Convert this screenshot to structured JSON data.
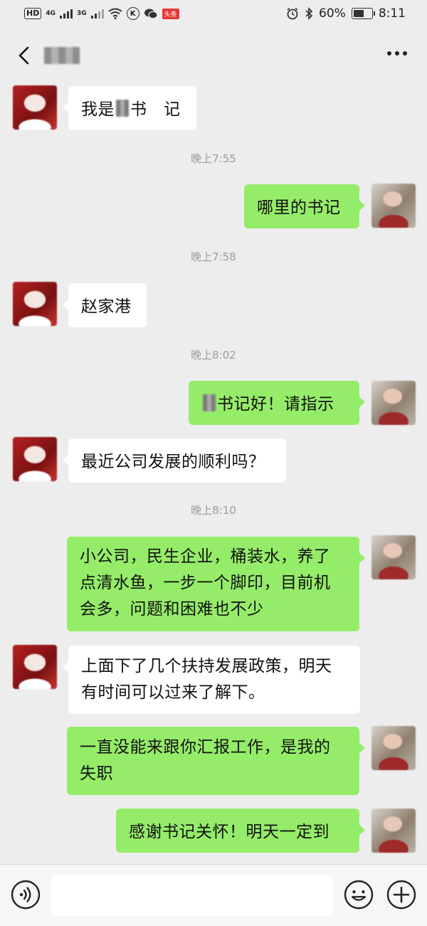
{
  "status_bar": {
    "hd": "HD",
    "net_4g": "4G",
    "net_3g": "3G",
    "k_icon": "K",
    "news_badge": "头条",
    "battery": "60%",
    "battery_level": 0.6,
    "time": "8:11"
  },
  "nav": {
    "back_icon": "chevron-left-icon",
    "more_icon": "ellipsis-icon"
  },
  "colors": {
    "outgoing_bubble": "#95ec69",
    "incoming_bubble": "#ffffff",
    "background": "#ededed"
  },
  "messages": [
    {
      "from": "other",
      "before": "我是",
      "after": "书　记"
    },
    {
      "type": "time",
      "text": "晚上7:55"
    },
    {
      "from": "me",
      "text": "哪里的书记"
    },
    {
      "type": "time",
      "text": "晚上7:58"
    },
    {
      "from": "other",
      "text": "赵家港"
    },
    {
      "type": "time",
      "text": "晚上8:02"
    },
    {
      "from": "me",
      "after": "书记好！请指示"
    },
    {
      "from": "other",
      "text": "最近公司发展的顺利吗？"
    },
    {
      "type": "time",
      "text": "晚上8:10"
    },
    {
      "from": "me",
      "lines": [
        "小公司，民生企业，桶装水，养了",
        "点清水鱼，一步一个脚印，目前机",
        "会多，问题和困难也不少"
      ]
    },
    {
      "from": "other",
      "lines": [
        "上面下了几个扶持发展政策，明天",
        "有时间可以过来了解下。"
      ]
    },
    {
      "from": "me",
      "lines": [
        "一直没能来跟你汇报工作，是我的",
        "失职"
      ]
    },
    {
      "from": "me",
      "text": "感谢书记关怀！明天一定到"
    }
  ],
  "input_bar": {
    "voice_icon": "voice-icon",
    "emoji_icon": "emoji-icon",
    "plus_icon": "plus-icon"
  }
}
